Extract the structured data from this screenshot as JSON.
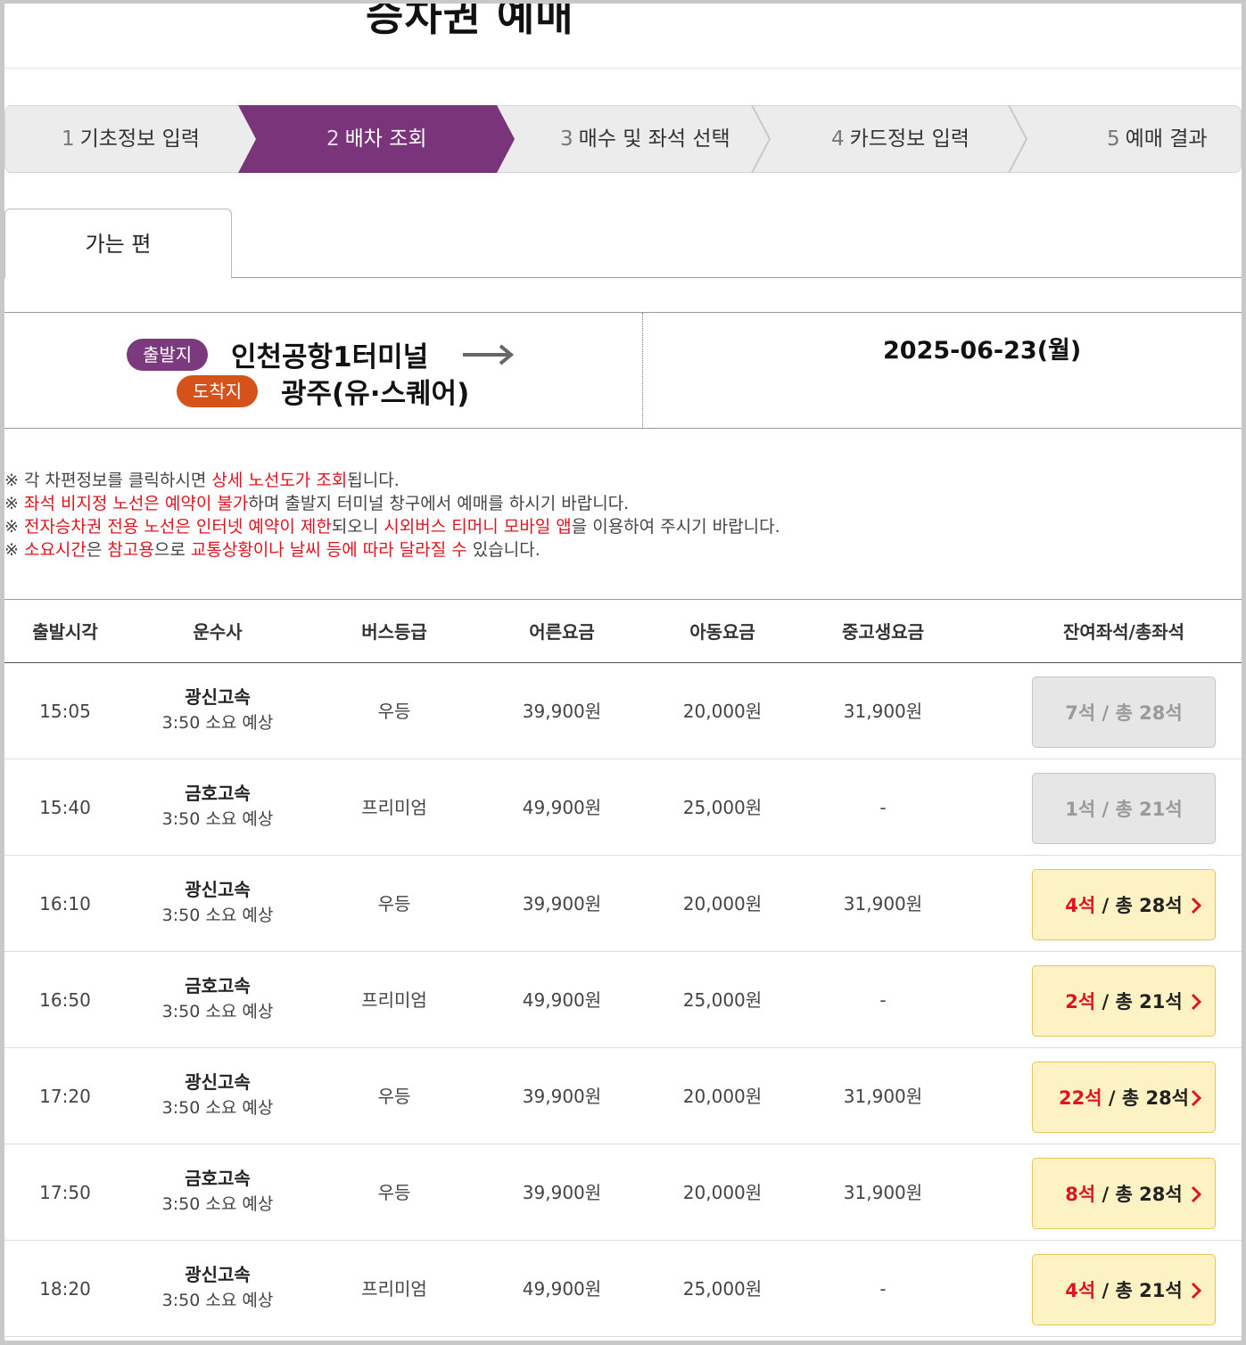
{
  "page": {
    "title": "승차권 예매"
  },
  "steps": [
    {
      "num": "1",
      "label": "기초정보 입력",
      "active": false
    },
    {
      "num": "2",
      "label": "배차 조회",
      "active": true
    },
    {
      "num": "3",
      "label": "매수 및 좌석 선택",
      "active": false
    },
    {
      "num": "4",
      "label": "카드정보 입력",
      "active": false
    },
    {
      "num": "5",
      "label": "예매 결과",
      "active": false
    }
  ],
  "tab": {
    "label": "가는 편"
  },
  "route": {
    "departure_badge": "출발지",
    "departure": "인천공항1터미널",
    "arrival_badge": "도착지",
    "arrival": "광주(유·스퀘어)",
    "arrow_icon": "right-arrow-icon",
    "date": "2025-06-23(월)"
  },
  "notices": [
    [
      {
        "t": "※ 각 차편정보를 클릭하시면 ",
        "red": false
      },
      {
        "t": "상세 노선도가 조회",
        "red": true
      },
      {
        "t": "됩니다.",
        "red": false
      }
    ],
    [
      {
        "t": "※ ",
        "red": false
      },
      {
        "t": "좌석 비지정 노선은 예약이 불가",
        "red": true
      },
      {
        "t": "하며 출발지 터미널 창구에서 예매를 하시기 바랍니다.",
        "red": false
      }
    ],
    [
      {
        "t": "※ ",
        "red": false
      },
      {
        "t": "전자승차권 전용 노선은 인터넷 예약이 제한",
        "red": true
      },
      {
        "t": "되오니 ",
        "red": false
      },
      {
        "t": "시외버스 티머니 모바일 앱",
        "red": true
      },
      {
        "t": "을 이용하여 주시기 바랍니다.",
        "red": false
      }
    ],
    [
      {
        "t": "※ ",
        "red": false
      },
      {
        "t": "소요시간",
        "red": true
      },
      {
        "t": "은 ",
        "red": false
      },
      {
        "t": "참고용",
        "red": true
      },
      {
        "t": "으로 ",
        "red": false
      },
      {
        "t": "교통상황이나 날씨 등에 따라 달라질 수",
        "red": true
      },
      {
        "t": " 있습니다.",
        "red": false
      }
    ]
  ],
  "table": {
    "headers": {
      "time": "출발시각",
      "company": "운수사",
      "grade": "버스등급",
      "adult": "어른요금",
      "child": "아동요금",
      "student": "중고생요금",
      "seats": "잔여좌석/총좌석"
    },
    "rows": [
      {
        "time": "15:05",
        "company": "광신고속",
        "duration": "3:50 소요 예상",
        "grade": "우등",
        "adult": "39,900원",
        "child": "20,000원",
        "student": "31,900원",
        "remain": "7석",
        "total": " / 총 28석",
        "available": false
      },
      {
        "time": "15:40",
        "company": "금호고속",
        "duration": "3:50 소요 예상",
        "grade": "프리미엄",
        "adult": "49,900원",
        "child": "25,000원",
        "student": "-",
        "remain": "1석",
        "total": " / 총 21석",
        "available": false
      },
      {
        "time": "16:10",
        "company": "광신고속",
        "duration": "3:50 소요 예상",
        "grade": "우등",
        "adult": "39,900원",
        "child": "20,000원",
        "student": "31,900원",
        "remain": "4석",
        "total": " / 총 28석",
        "available": true
      },
      {
        "time": "16:50",
        "company": "금호고속",
        "duration": "3:50 소요 예상",
        "grade": "프리미엄",
        "adult": "49,900원",
        "child": "25,000원",
        "student": "-",
        "remain": "2석",
        "total": " / 총 21석",
        "available": true
      },
      {
        "time": "17:20",
        "company": "광신고속",
        "duration": "3:50 소요 예상",
        "grade": "우등",
        "adult": "39,900원",
        "child": "20,000원",
        "student": "31,900원",
        "remain": "22석",
        "total": " / 총 28석",
        "available": true
      },
      {
        "time": "17:50",
        "company": "금호고속",
        "duration": "3:50 소요 예상",
        "grade": "우등",
        "adult": "39,900원",
        "child": "20,000원",
        "student": "31,900원",
        "remain": "8석",
        "total": " / 총 28석",
        "available": true
      },
      {
        "time": "18:20",
        "company": "광신고속",
        "duration": "3:50 소요 예상",
        "grade": "프리미엄",
        "adult": "49,900원",
        "child": "25,000원",
        "student": "-",
        "remain": "4석",
        "total": " / 총 21석",
        "available": true
      }
    ]
  },
  "colors": {
    "step_active": "#7a3479",
    "departure_badge": "#7a3a7d",
    "arrival_badge": "#d4531b",
    "highlight_red": "#e0141e",
    "seat_available_bg": "#fdf2c4",
    "seat_soldout_bg": "#e6e6e6"
  }
}
